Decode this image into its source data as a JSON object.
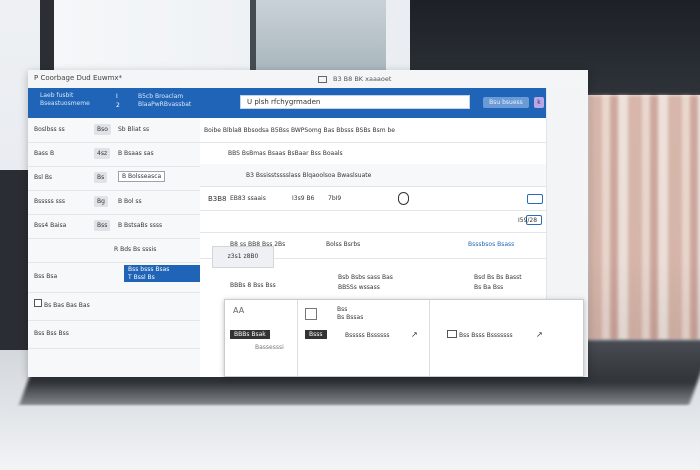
{
  "window": {
    "title": "P Coorbage Dud Euwmx*",
    "path": "B3 B8 BK xaaaoet"
  },
  "header": {
    "left_line1": "Laeb fusbit",
    "left_line2": "Bseastuosmeme",
    "mid_line1": "I",
    "mid_line2": "2",
    "mid2_line1": "B5cb Broaclam",
    "mid2_line2": "BlaaPwRBvassbat",
    "search_value": "U plsh rfchygrmaden",
    "button_label": "Bsu bsuess",
    "button2_label": "k"
  },
  "sidebar": {
    "rows": [
      {
        "label": "Boslbss ss",
        "chip": "Bso",
        "right": "Sb Bliat ss"
      },
      {
        "label": "Bass B",
        "chip": "4sz",
        "right": "B Bsaas sas"
      },
      {
        "label": "Bsl Bs",
        "chip": "Bs",
        "right": "B Bolsseasca",
        "right_boxed": true
      },
      {
        "label": "Bsssss sss",
        "chip": "Bg",
        "right": "B Bol ss"
      },
      {
        "label": "Bss4 Baisa",
        "chip": "Bss",
        "right": "B BstsaBs ssss"
      },
      {
        "label": "",
        "chip": "",
        "right": "R Bds Bs sssis"
      },
      {
        "label": "Bss Bsa",
        "chip": "Bss",
        "selected_line1": "Bss bsss Bsas",
        "selected_line2": "T Bssl Bs"
      },
      {
        "label": "Bs Bas Bas Bas",
        "checkbox": true
      },
      {
        "label": "Bss Bss Bss"
      }
    ]
  },
  "main": {
    "row1": "Boibe Blbla8 Bbsodsa    B5Bss BWPSomg    Bas Bbsss    BSBs Bsm be",
    "row2": "BBS BsBmas      Bsaas BsBaar      Bss Boaals",
    "row3": "B3 Bssisstsssslass Blqaoolsoa Bwaslsuate",
    "row4_a": "B3B8",
    "row4_b": "EB83 ssaais",
    "row4_c": "I3s9 B6",
    "row4_d": "7bI9",
    "row4_e": "I59/28",
    "row5_left": "B8 ss BB8 Bss 2Bs",
    "row5_mid": "Bolss Bsrbs",
    "row5_right": "Bsssbsos Bsass",
    "card_label": "z3s1 z8B0",
    "row6_left": "BBBs 8 Bss Bss",
    "row6_mid1": "Bsb Bsbs sass Bas",
    "row6_mid2": "BBSSs wssass",
    "row6_right1": "Bsd Bs Bs Basst",
    "row6_right2": "Bs Ba Bss"
  },
  "dialog": {
    "col1_label": "AA",
    "col1_btn": "BBBs Bsak",
    "col1_sub": "Bassesssi",
    "col2_line1": "Bss",
    "col2_line2": "Bs Bssas",
    "col2_btn": "Bsss",
    "col2_text": "Bsssss Bssssss",
    "col3_text": "Bss Bsss Bsssssss"
  }
}
